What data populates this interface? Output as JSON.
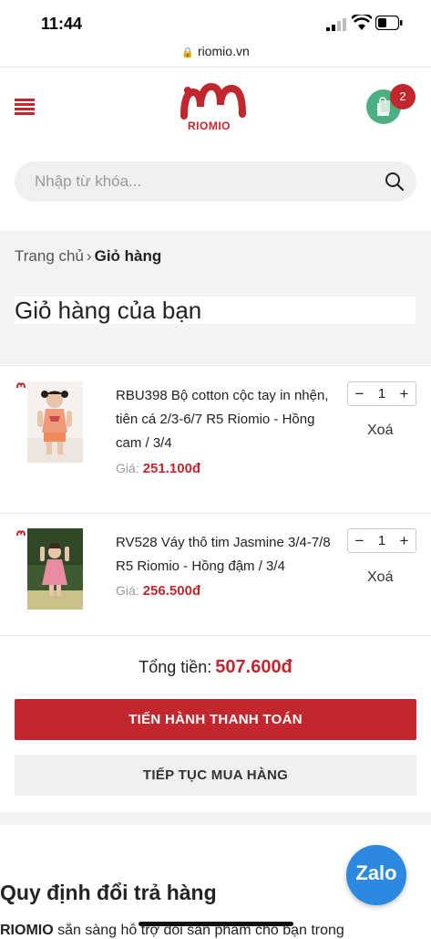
{
  "status_bar": {
    "time": "11:44"
  },
  "browser": {
    "url": "riomio.vn"
  },
  "header": {
    "logo_text": "RIOMIO",
    "cart_count": "2"
  },
  "search": {
    "placeholder": "Nhập từ khóa..."
  },
  "breadcrumb": {
    "home": "Trang chủ",
    "separator": "›",
    "current": "Giỏ hàng"
  },
  "page_title": "Giỏ hàng của bạn",
  "cart": {
    "items": [
      {
        "name": "RBU398 Bộ cotton cộc tay in nhện, tiên cá 2/3-6/7 R5 Riomio - Hồng cam / 3/4",
        "price_label": "Giá:",
        "price": "251.100đ",
        "qty": "1",
        "remove_label": "Xoá"
      },
      {
        "name": "RV528 Váy thô tim Jasmine 3/4-7/8 R5 Riomio - Hồng đậm / 3/4",
        "price_label": "Giá:",
        "price": "256.500đ",
        "qty": "1",
        "remove_label": "Xoá"
      }
    ],
    "total_label": "Tổng tiền:",
    "total": "507.600đ",
    "checkout_label": "TIẾN HÀNH THANH TOÁN",
    "continue_label": "TIẾP TỤC MUA HÀNG"
  },
  "policy": {
    "title": "Quy định đổi trả hàng",
    "brand": "RIOMIO",
    "text": " sẵn sàng hỗ trợ đổi sản phẩm cho bạn trong"
  },
  "zalo": {
    "label": "Zalo"
  },
  "colors": {
    "accent": "#c1272d",
    "cart_button": "#4caf82",
    "zalo": "#2b8ae0"
  }
}
